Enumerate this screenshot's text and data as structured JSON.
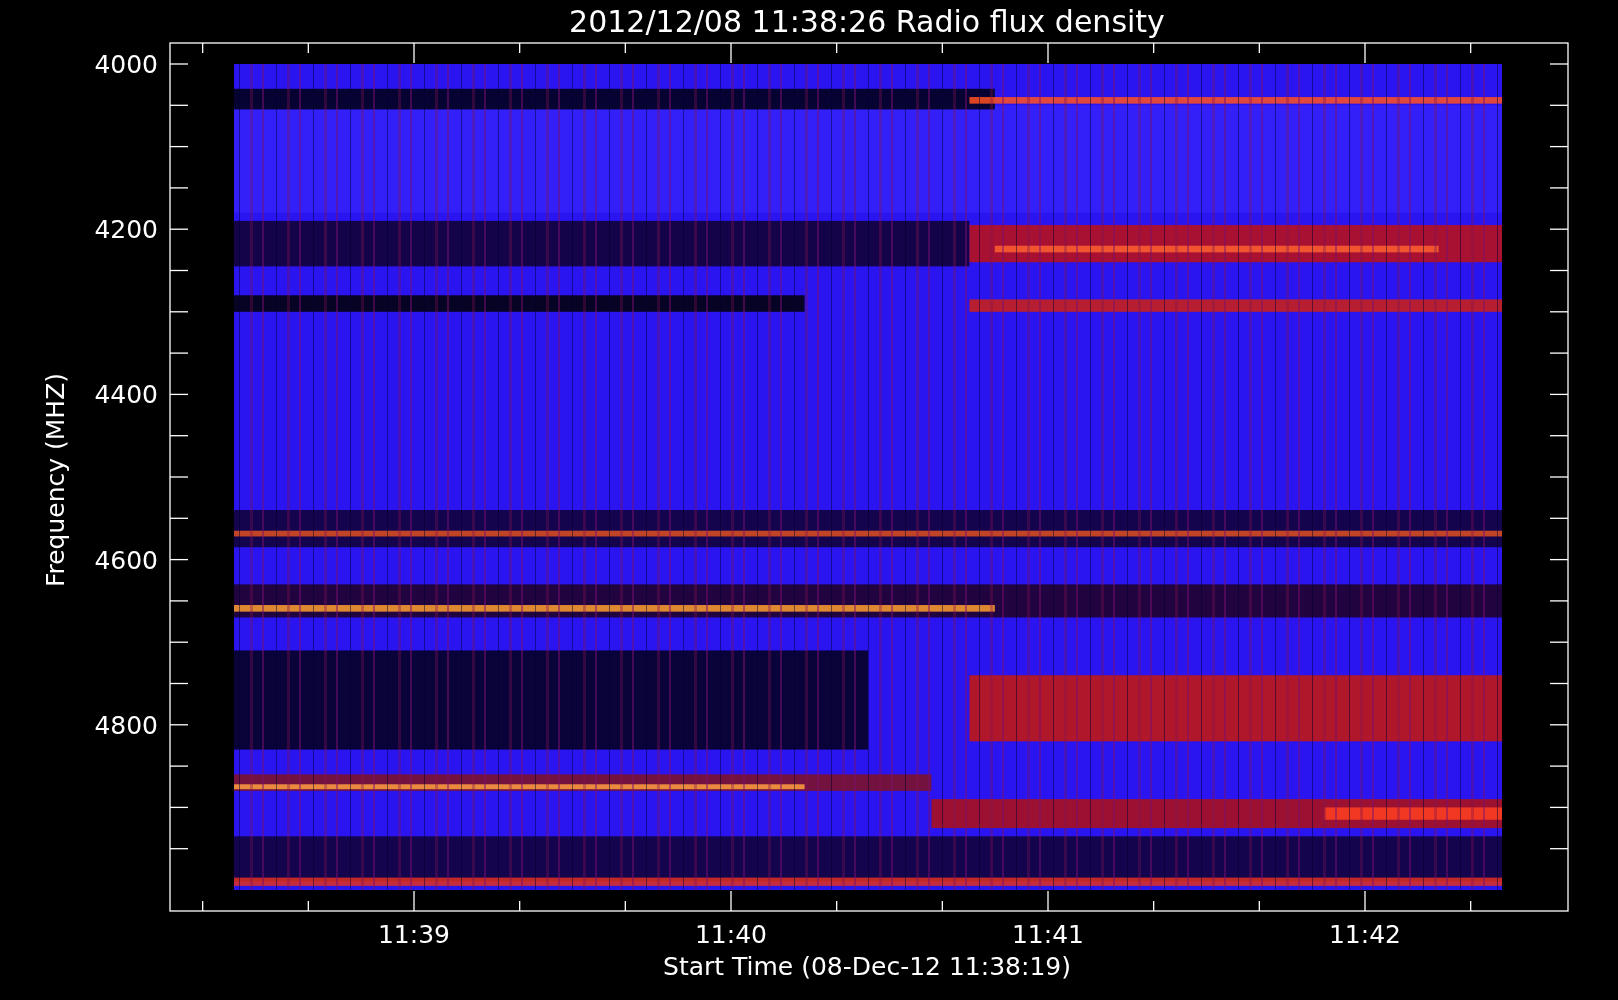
{
  "title": "2012/12/08 11:38:26 Radio flux density",
  "y_axis": {
    "label": "Frequency (MHZ)",
    "tick_labels": [
      "4000",
      "4200",
      "4400",
      "4600",
      "4800"
    ]
  },
  "x_axis": {
    "label": "Start Time (08-Dec-12 11:38:19)",
    "tick_labels": [
      "11:39",
      "11:40",
      "11:41",
      "11:42"
    ]
  }
}
